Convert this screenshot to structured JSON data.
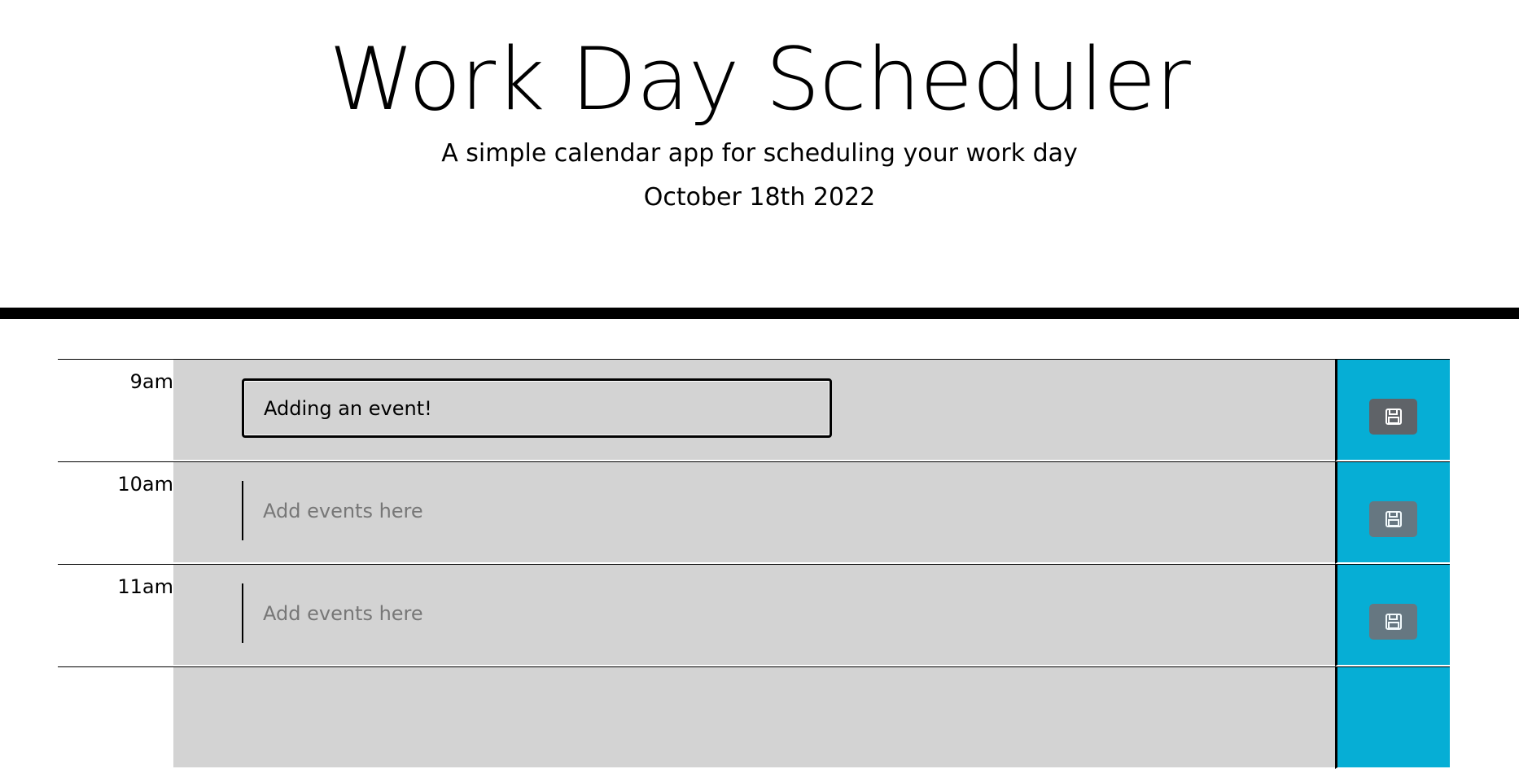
{
  "header": {
    "title": "Work Day Scheduler",
    "subtitle": "A simple calendar app for scheduling your work day",
    "date": "October 18th 2022"
  },
  "schedule": {
    "rows": [
      {
        "hour": "9am",
        "value": "Adding an event!",
        "placeholder": "Add events here"
      },
      {
        "hour": "10am",
        "value": "",
        "placeholder": "Add events here"
      },
      {
        "hour": "11am",
        "value": "",
        "placeholder": "Add events here"
      }
    ],
    "save_icon": "floppy-disk-icon"
  },
  "colors": {
    "event_bg": "#d3d3d3",
    "save_bg": "#06aed5",
    "button_bg": "#5f6368"
  }
}
